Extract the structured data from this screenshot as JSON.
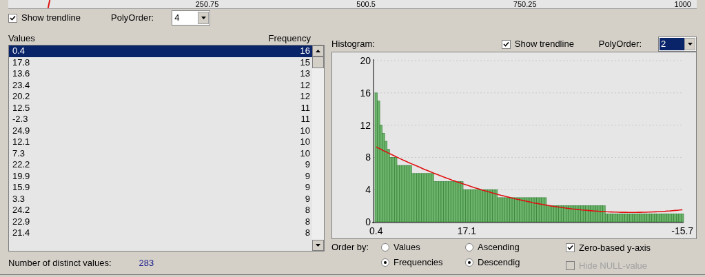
{
  "top_axis": {
    "labels": [
      "250.75",
      "500.5",
      "750.25",
      "1000"
    ]
  },
  "left": {
    "show_trendline": {
      "label": "Show trendline",
      "checked": true
    },
    "poly_order": {
      "label": "PolyOrder:",
      "value": "4"
    },
    "columns": [
      "Values",
      "Frequency"
    ],
    "rows": [
      {
        "value": "0.4",
        "frequency": "16",
        "selected": true
      },
      {
        "value": "17.8",
        "frequency": "15",
        "selected": false
      },
      {
        "value": "13.6",
        "frequency": "13",
        "selected": false
      },
      {
        "value": "23.4",
        "frequency": "12",
        "selected": false
      },
      {
        "value": "20.2",
        "frequency": "12",
        "selected": false
      },
      {
        "value": "12.5",
        "frequency": "11",
        "selected": false
      },
      {
        "value": "-2.3",
        "frequency": "11",
        "selected": false
      },
      {
        "value": "24.9",
        "frequency": "10",
        "selected": false
      },
      {
        "value": "12.1",
        "frequency": "10",
        "selected": false
      },
      {
        "value": "7.3",
        "frequency": "10",
        "selected": false
      },
      {
        "value": "22.2",
        "frequency": "9",
        "selected": false
      },
      {
        "value": "19.9",
        "frequency": "9",
        "selected": false
      },
      {
        "value": "15.9",
        "frequency": "9",
        "selected": false
      },
      {
        "value": "3.3",
        "frequency": "9",
        "selected": false
      },
      {
        "value": "24.2",
        "frequency": "8",
        "selected": false
      },
      {
        "value": "22.9",
        "frequency": "8",
        "selected": false
      },
      {
        "value": "21.4",
        "frequency": "8",
        "selected": false
      }
    ],
    "distinct_label": "Number of distinct values:",
    "distinct_count": "283"
  },
  "right": {
    "title": "Histogram:",
    "show_trendline": {
      "label": "Show trendline",
      "checked": true
    },
    "poly_order": {
      "label": "PolyOrder:",
      "value": "2"
    },
    "chart_data": {
      "type": "bar",
      "grid": true,
      "yticks": [
        0,
        4,
        8,
        12,
        16,
        20
      ],
      "ylim": [
        0,
        20
      ],
      "categories": [
        "0.4",
        null,
        null,
        null,
        null,
        null,
        null,
        null,
        null,
        null,
        null,
        null,
        null,
        null,
        null,
        null,
        null,
        null,
        null,
        null,
        null,
        null,
        null,
        null,
        null,
        null,
        null,
        null,
        null,
        null,
        null,
        null,
        null,
        null,
        null,
        null,
        null,
        "17.1",
        null,
        null,
        null,
        null,
        null,
        null,
        null,
        null,
        null,
        null,
        null,
        null,
        null,
        null,
        null,
        null,
        null,
        null,
        null,
        null,
        null,
        null,
        null,
        null,
        null,
        null,
        null,
        null,
        null,
        null,
        null,
        null,
        null,
        null,
        null,
        null,
        null,
        null,
        null,
        null,
        null,
        null,
        null,
        null,
        null,
        null,
        null,
        null,
        null,
        null,
        null,
        null,
        null,
        null,
        null,
        null,
        null,
        null,
        null,
        null,
        null,
        null,
        null,
        null,
        null,
        null,
        null,
        null,
        null,
        null,
        null,
        null,
        null,
        null,
        null,
        null,
        null,
        null,
        null,
        null,
        null,
        null,
        null,
        null,
        null,
        null,
        null,
        "-15.7"
      ],
      "series": [
        {
          "color": "#6cb46c",
          "values": [
            16,
            15,
            12,
            11,
            10,
            9,
            8,
            8,
            8,
            7,
            7,
            7,
            7,
            7,
            7,
            6,
            6,
            6,
            6,
            6,
            6,
            6,
            6,
            6,
            5,
            5,
            5,
            5,
            5,
            5,
            5,
            5,
            5,
            5,
            5,
            5,
            4,
            4,
            4,
            4,
            4,
            4,
            4,
            4,
            4,
            4,
            4,
            4,
            4,
            4,
            3,
            3,
            3,
            3,
            3,
            3,
            3,
            3,
            3,
            3,
            3,
            3,
            3,
            3,
            3,
            3,
            3,
            3,
            3,
            3,
            2,
            2,
            2,
            2,
            2,
            2,
            2,
            2,
            2,
            2,
            2,
            2,
            2,
            2,
            2,
            2,
            2,
            2,
            2,
            2,
            2,
            2,
            2,
            2,
            1,
            1,
            1,
            1,
            1,
            1,
            1,
            1,
            1,
            1,
            1,
            1,
            1,
            1,
            1,
            1,
            1,
            1,
            1,
            1,
            1,
            1,
            1,
            1,
            1,
            1,
            1,
            1,
            1,
            1,
            1,
            1
          ]
        },
        {
          "type": "line",
          "color": "#e01010",
          "values": [
            9.3,
            9.15,
            9.0,
            8.84,
            8.69,
            8.54,
            8.39,
            8.25,
            8.1,
            7.96,
            7.81,
            7.67,
            7.54,
            7.4,
            7.27,
            7.13,
            7.0,
            6.87,
            6.74,
            6.61,
            6.48,
            6.36,
            6.24,
            6.11,
            5.99,
            5.87,
            5.75,
            5.64,
            5.52,
            5.41,
            5.29,
            5.18,
            5.08,
            4.97,
            4.87,
            4.76,
            4.66,
            4.56,
            4.46,
            4.36,
            4.26,
            4.17,
            4.08,
            3.98,
            3.89,
            3.8,
            3.71,
            3.63,
            3.54,
            3.46,
            3.37,
            3.29,
            3.22,
            3.14,
            3.07,
            2.99,
            2.92,
            2.85,
            2.78,
            2.71,
            2.64,
            2.58,
            2.51,
            2.45,
            2.38,
            2.32,
            2.27,
            2.21,
            2.16,
            2.1,
            2.05,
            2.0,
            1.95,
            1.91,
            1.86,
            1.81,
            1.77,
            1.73,
            1.69,
            1.65,
            1.61,
            1.58,
            1.55,
            1.51,
            1.48,
            1.45,
            1.43,
            1.4,
            1.38,
            1.35,
            1.33,
            1.31,
            1.29,
            1.28,
            1.26,
            1.24,
            1.23,
            1.22,
            1.21,
            1.2,
            1.19,
            1.19,
            1.19,
            1.18,
            1.18,
            1.18,
            1.18,
            1.19,
            1.19,
            1.2,
            1.2,
            1.21,
            1.22,
            1.24,
            1.25,
            1.26,
            1.28,
            1.3,
            1.32,
            1.34,
            1.36,
            1.39,
            1.42,
            1.44,
            1.47,
            1.5
          ]
        }
      ]
    },
    "order_label": "Order by:",
    "order_options": [
      {
        "label": "Values",
        "selected": false
      },
      {
        "label": "Frequencies",
        "selected": true
      }
    ],
    "direction_options": [
      {
        "label": "Ascending",
        "selected": false
      },
      {
        "label": "Descendig",
        "selected": true
      }
    ],
    "zero_based": {
      "label": "Zero-based y-axis",
      "checked": true,
      "disabled": false
    },
    "hide_null": {
      "label": "Hide NULL-value",
      "checked": false,
      "disabled": true
    }
  }
}
